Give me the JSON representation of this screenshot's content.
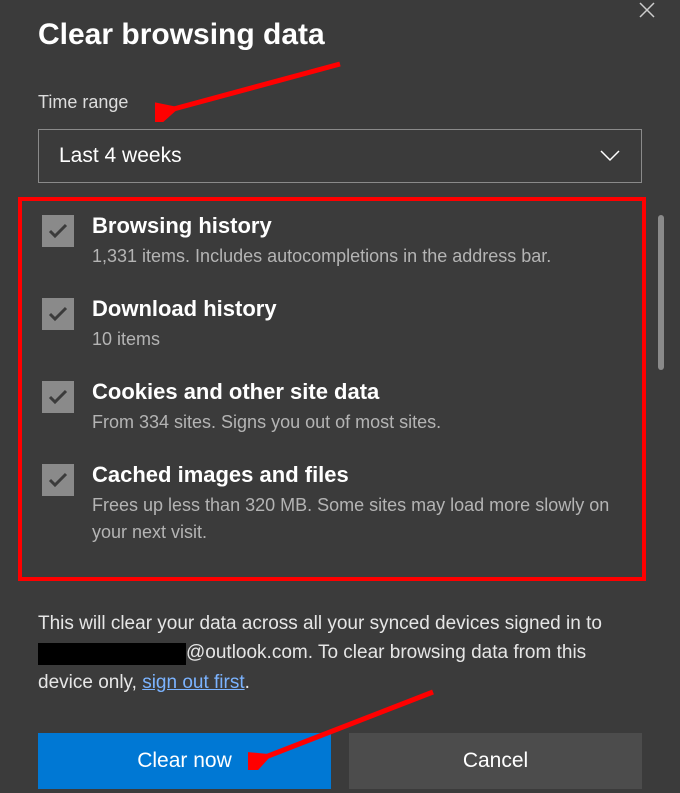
{
  "title": "Clear browsing data",
  "time_range_label": "Time range",
  "time_range_value": "Last 4 weeks",
  "items": [
    {
      "title": "Browsing history",
      "desc": "1,331 items. Includes autocompletions in the address bar."
    },
    {
      "title": "Download history",
      "desc": "10 items"
    },
    {
      "title": "Cookies and other site data",
      "desc": "From 334 sites. Signs you out of most sites."
    },
    {
      "title": "Cached images and files",
      "desc": "Frees up less than 320 MB. Some sites may load more slowly on your next visit."
    }
  ],
  "notice_prefix": "This will clear your data across all your synced devices signed in to ",
  "notice_email_suffix": "@outlook.com. To clear browsing data from this device only, ",
  "notice_link": "sign out first",
  "notice_period": ".",
  "buttons": {
    "primary": "Clear now",
    "secondary": "Cancel"
  }
}
